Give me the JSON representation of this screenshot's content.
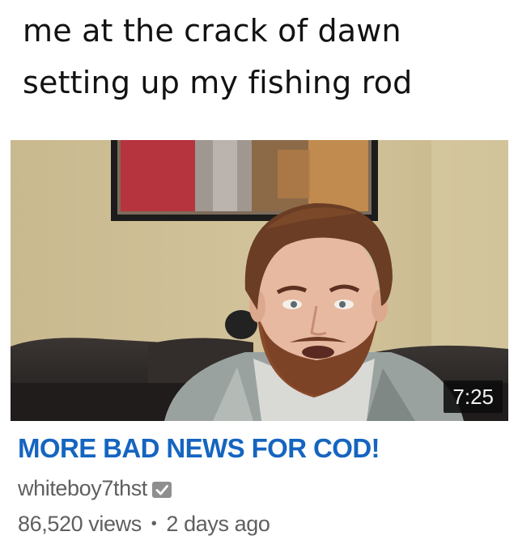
{
  "meme_caption": "me at the crack of dawn\nsetting up my fishing rod",
  "video": {
    "duration": "7:25",
    "title": "MORE BAD NEWS FOR COD!",
    "channel": "whiteboy7thst",
    "verified_icon": "verified-check-icon",
    "views": "86,520 views",
    "separator": "•",
    "age": "2 days ago"
  },
  "colors": {
    "title_link": "#1565c0",
    "meta_text": "#5f5f5f",
    "duration_badge_bg": "#0c0c0c",
    "wall": "#cdbd93",
    "couch": "#2e2a29"
  }
}
